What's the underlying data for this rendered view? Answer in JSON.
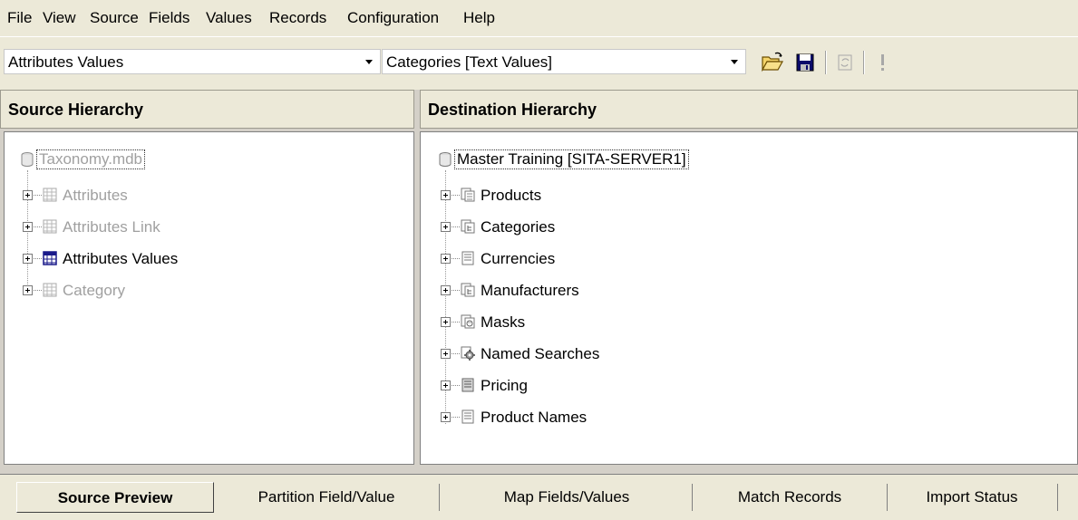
{
  "menu": [
    "File",
    "View",
    "Source",
    "Fields",
    "Values",
    "Records",
    "Configuration",
    "Help"
  ],
  "toolbar": {
    "source_table": "Attributes Values",
    "dest_table": "Categories [Text Values]"
  },
  "source": {
    "header": "Source Hierarchy",
    "root": "Taxonomy.mdb",
    "items": [
      {
        "label": "Attributes",
        "icon": "table-icon",
        "active": false
      },
      {
        "label": "Attributes Link",
        "icon": "table-icon",
        "active": false
      },
      {
        "label": "Attributes Values",
        "icon": "table-icon",
        "active": true
      },
      {
        "label": "Category",
        "icon": "table-icon",
        "active": false
      }
    ]
  },
  "destination": {
    "header": "Destination Hierarchy",
    "root": "Master Training [SITA-SERVER1]",
    "items": [
      {
        "label": "Products",
        "icon": "main-table-icon"
      },
      {
        "label": "Categories",
        "icon": "hierarchy-table-icon"
      },
      {
        "label": "Currencies",
        "icon": "flat-table-icon"
      },
      {
        "label": "Manufacturers",
        "icon": "hierarchy-table-icon"
      },
      {
        "label": "Masks",
        "icon": "masks-table-icon"
      },
      {
        "label": "Named Searches",
        "icon": "named-searches-icon"
      },
      {
        "label": "Pricing",
        "icon": "flat-table-icon"
      },
      {
        "label": "Product Names",
        "icon": "flat-table-icon"
      }
    ]
  },
  "tabs": [
    "Source Preview",
    "Partition Field/Value",
    "Map Fields/Values",
    "Match Records",
    "Import Status"
  ]
}
